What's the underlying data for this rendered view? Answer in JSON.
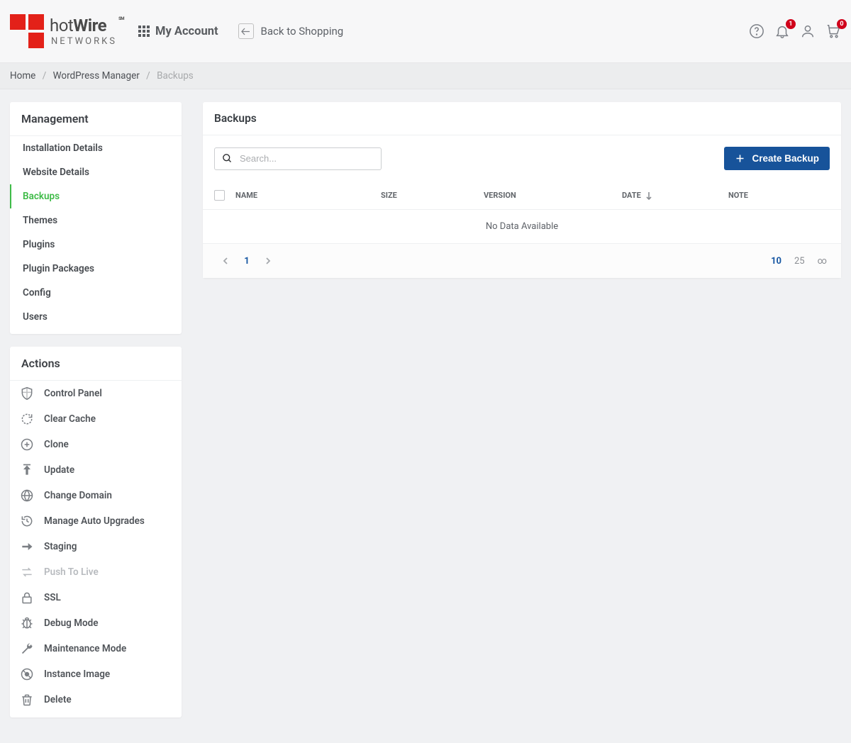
{
  "header": {
    "logo_main_a": "hot",
    "logo_main_b": "Wire",
    "logo_sm": "SM",
    "logo_sub": "NETWORKS",
    "my_account": "My Account",
    "back_to_shopping": "Back to Shopping",
    "notif_badge": "1",
    "cart_badge": "0"
  },
  "breadcrumb": {
    "home": "Home",
    "wp": "WordPress Manager",
    "current": "Backups"
  },
  "sidebar": {
    "mgmt_title": "Management",
    "mgmt": [
      {
        "label": "Installation Details"
      },
      {
        "label": "Website Details"
      },
      {
        "label": "Backups"
      },
      {
        "label": "Themes"
      },
      {
        "label": "Plugins"
      },
      {
        "label": "Plugin Packages"
      },
      {
        "label": "Config"
      },
      {
        "label": "Users"
      }
    ],
    "actions_title": "Actions",
    "actions": [
      {
        "label": "Control Panel"
      },
      {
        "label": "Clear Cache"
      },
      {
        "label": "Clone"
      },
      {
        "label": "Update"
      },
      {
        "label": "Change Domain"
      },
      {
        "label": "Manage Auto Upgrades"
      },
      {
        "label": "Staging"
      },
      {
        "label": "Push To Live"
      },
      {
        "label": "SSL"
      },
      {
        "label": "Debug Mode"
      },
      {
        "label": "Maintenance Mode"
      },
      {
        "label": "Instance Image"
      },
      {
        "label": "Delete"
      }
    ]
  },
  "main": {
    "title": "Backups",
    "search_placeholder": "Search...",
    "create_backup": "Create Backup",
    "columns": {
      "name": "NAME",
      "size": "SIZE",
      "version": "VERSION",
      "date": "DATE",
      "note": "NOTE"
    },
    "empty": "No Data Available",
    "page": "1",
    "sizes": {
      "s10": "10",
      "s25": "25",
      "sinf": "∞"
    }
  }
}
